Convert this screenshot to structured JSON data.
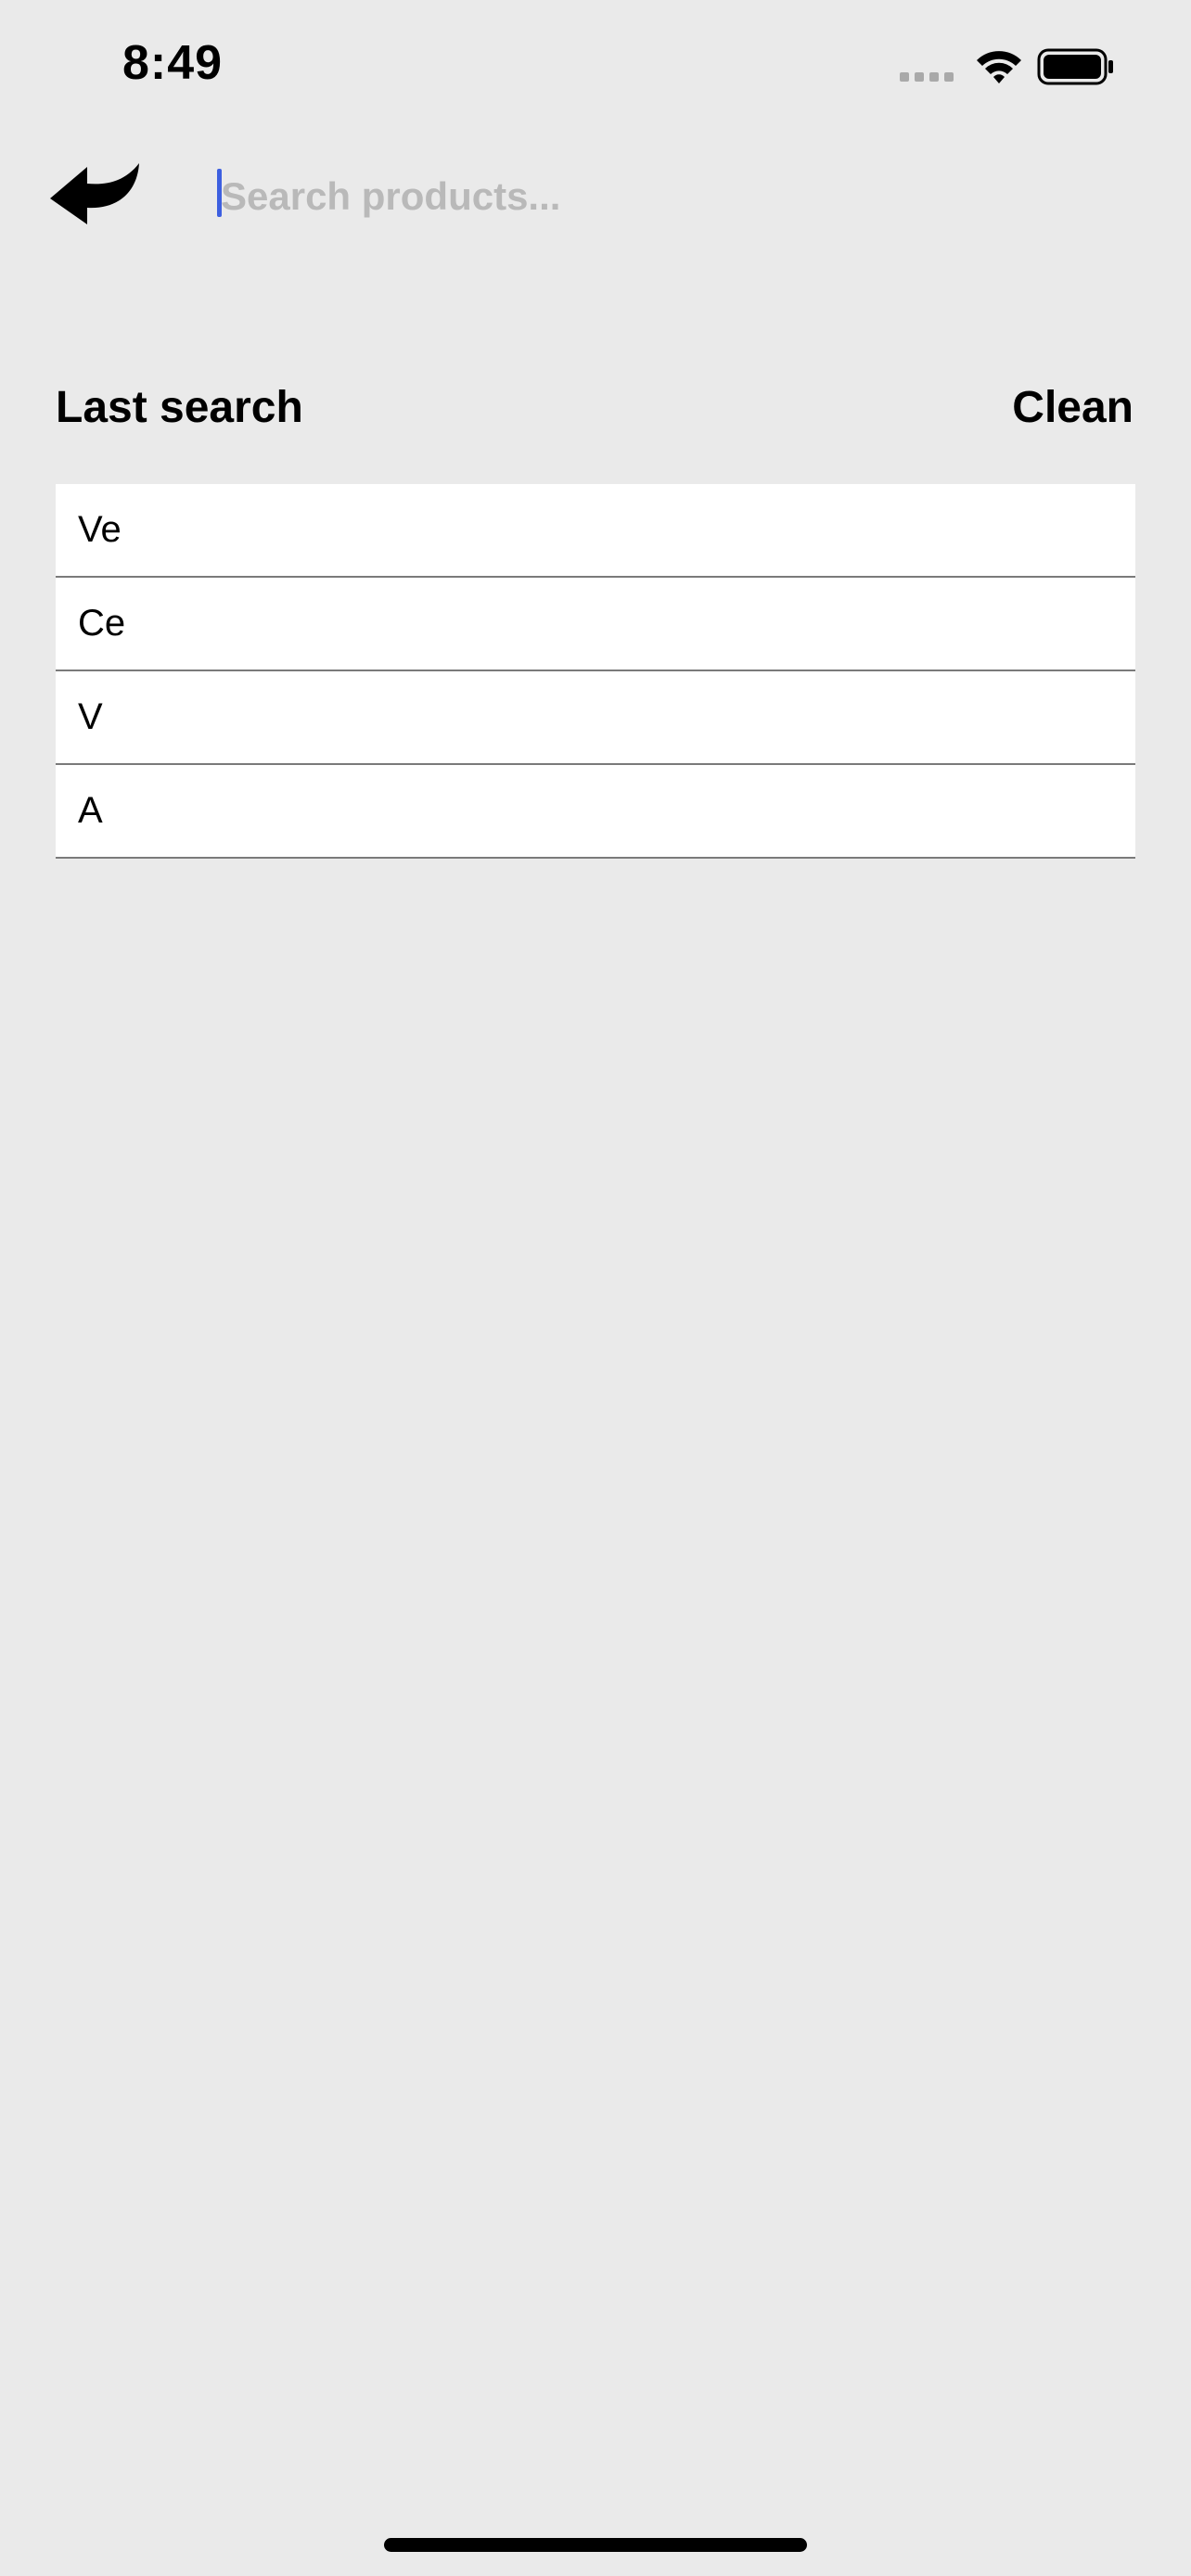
{
  "status_bar": {
    "time": "8:49",
    "icons": [
      "cell-signal-icon",
      "wifi-icon",
      "battery-icon"
    ]
  },
  "search": {
    "back_icon": "back-arrow-icon",
    "placeholder": "Search products...",
    "value": ""
  },
  "history": {
    "title": "Last search",
    "clean_label": "Clean",
    "items": [
      {
        "label": "Ve"
      },
      {
        "label": "Ce"
      },
      {
        "label": "V"
      },
      {
        "label": "A"
      }
    ]
  },
  "colors": {
    "background": "#eaeaea",
    "caret": "#3d5fe0",
    "placeholder": "#b9b9b9",
    "row_background": "#ffffff",
    "row_divider": "#7a7a7a"
  }
}
